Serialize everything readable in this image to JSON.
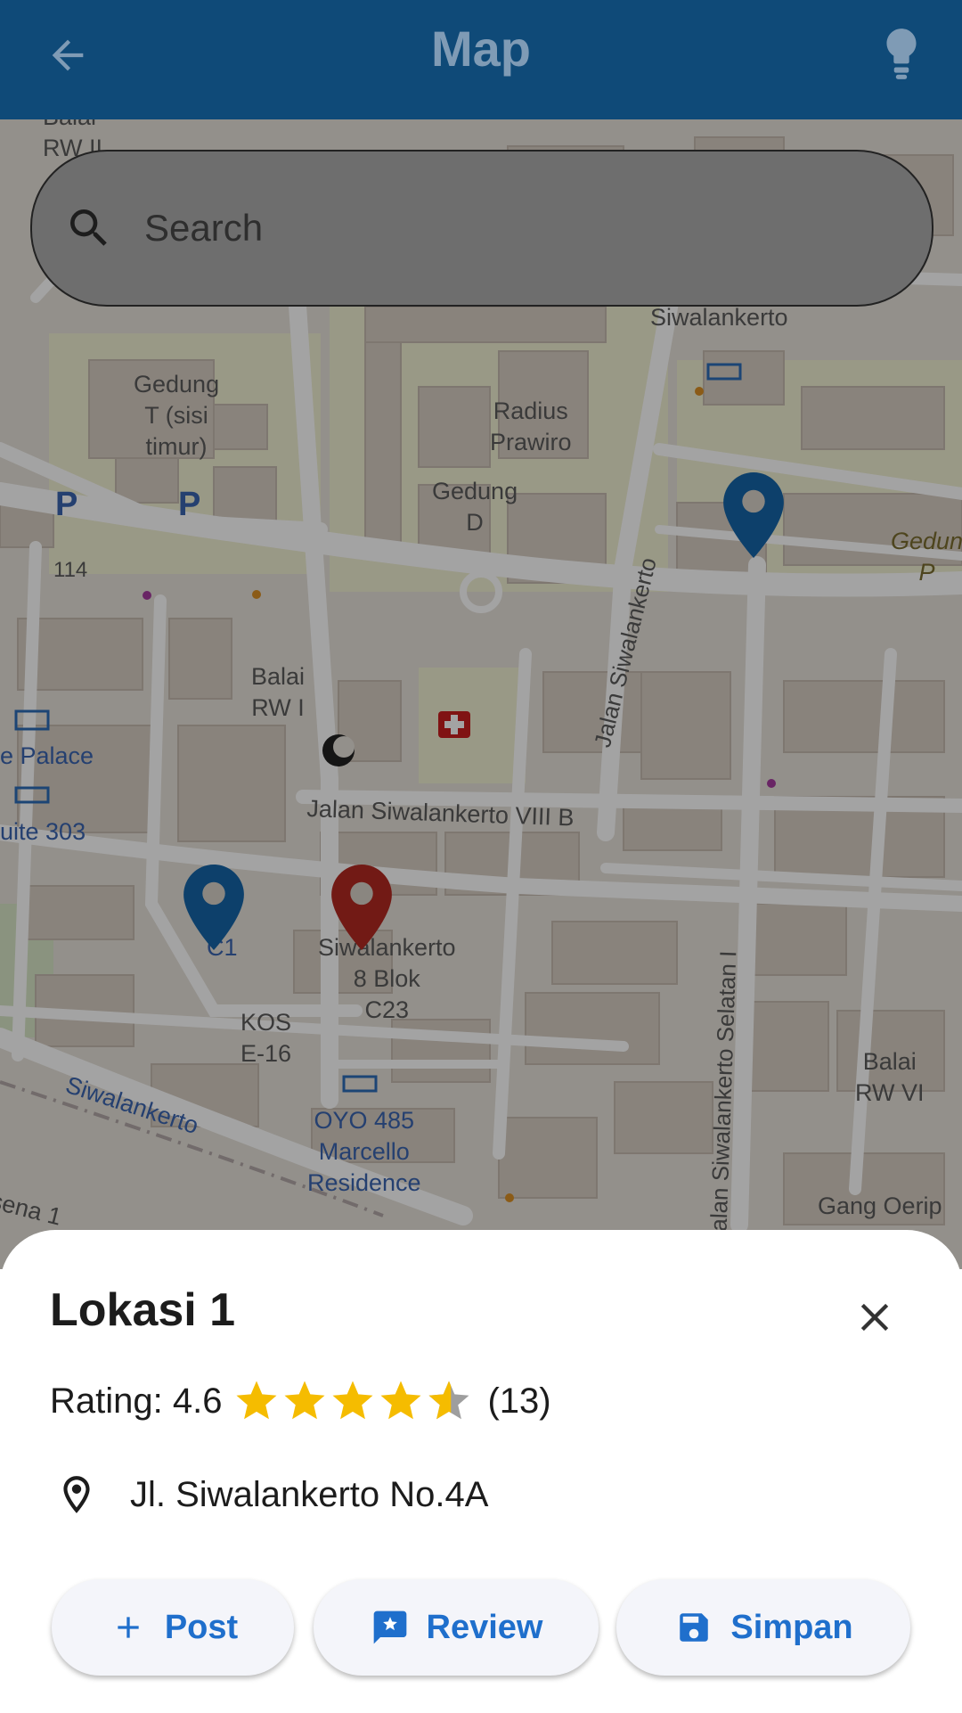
{
  "appbar": {
    "title": "Map",
    "back_icon": "arrow-back-icon",
    "right_icon": "lightbulb-icon",
    "bg_color": "#0f4a78"
  },
  "search": {
    "placeholder": "Search",
    "value": "",
    "icon": "search-icon"
  },
  "map": {
    "labels": {
      "balai_rw_ii": "Balai\nRW II",
      "siwalankerto_top": "Siwalankerto",
      "gedung_t": "Gedung\nT (sisi\ntimur)",
      "radius_prawiro": "Radius\nPrawiro",
      "gedung_d": "Gedung\nD",
      "gedung_p": "Gedun\nP",
      "jalan_siwalankerto": "Jalan Siwalankerto",
      "num_114": "114",
      "balai_rw_i": "Balai\nRW I",
      "palace": "e Palace",
      "suite": "uite 303",
      "jalan_viii_b": "Jalan Siwalankerto VIII B",
      "c1": "C1",
      "siwalankerto_8_blok": "Siwalankerto\n8 Blok\nC23",
      "kos": "KOS\nE-16",
      "oyo": "OYO 485\nMarcello\nResidence",
      "siwalankerto_road": "Siwalankerto",
      "jalan_selatan": "Jalan Siwalankerto Selatan I",
      "balai_rw_vi": "Balai\nRW VI",
      "gang_oerip": "Gang Oerip",
      "sena": "sena 1",
      "parking": "P"
    },
    "markers": [
      {
        "name": "marker-blue-1",
        "color": "#1565a8"
      },
      {
        "name": "marker-blue-2",
        "color": "#1565a8"
      },
      {
        "name": "marker-red-selected",
        "color": "#b32a22"
      }
    ]
  },
  "sheet": {
    "title": "Lokasi 1",
    "rating_label": "Rating: 4.6",
    "rating_value": 4.6,
    "rating_count": "(13)",
    "address": "Jl. Siwalankerto No.4A",
    "close_icon": "close-icon",
    "star_color": "#f5bc00",
    "buttons": {
      "post": "Post",
      "review": "Review",
      "save": "Simpan"
    },
    "button_color": "#1f6fcc"
  }
}
